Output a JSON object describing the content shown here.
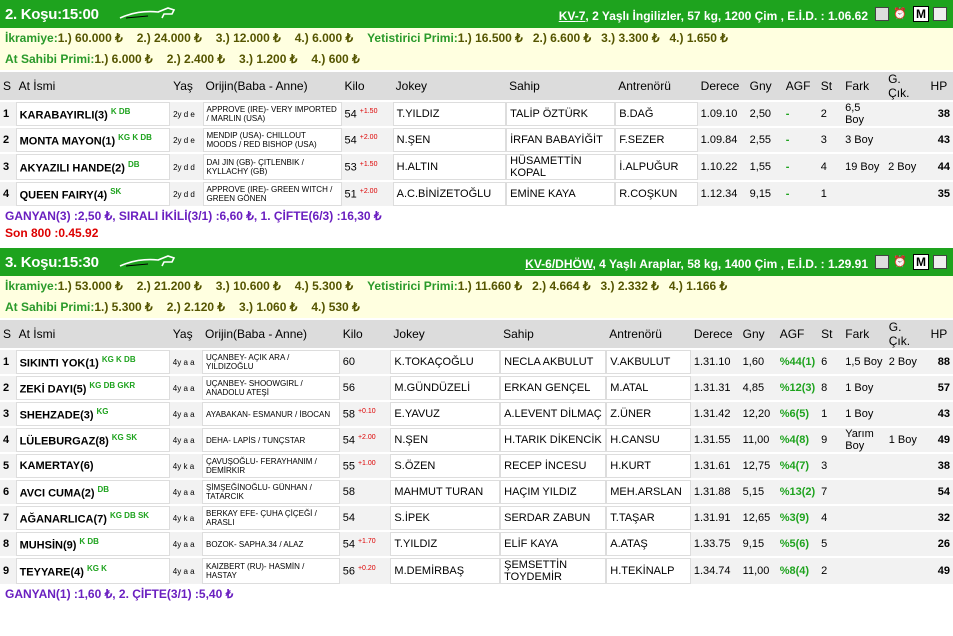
{
  "races": [
    {
      "title": "2. Koşu:15:00",
      "kv": "KV-7",
      "info": ", 2 Yaşlı İngilizler, 57 kg, 1200 Çim , E.İ.D. : 1.06.62",
      "ikramiye_label": "İkramiye:",
      "ikramiye": [
        "1.) 60.000 ₺",
        "2.) 24.000 ₺",
        "3.) 12.000 ₺",
        "4.) 6.000 ₺"
      ],
      "yet_label": "Yetistirici Primi:",
      "yet": [
        "1.) 16.500 ₺",
        "2.) 6.600 ₺",
        "3.) 3.300 ₺",
        "4.) 1.650 ₺"
      ],
      "sahip_label": "At Sahibi Primi:",
      "sahip": [
        "1.) 6.000 ₺",
        "2.) 2.400 ₺",
        "3.) 1.200 ₺",
        "4.) 600 ₺"
      ],
      "headers": [
        "S",
        "At İsmi",
        "Yaş",
        "Orijin(Baba - Anne)",
        "Kilo",
        "Jokey",
        "Sahip",
        "Antrenörü",
        "Derece",
        "Gny",
        "AGF",
        "St",
        "Fark",
        "G. Çık.",
        "HP"
      ],
      "rows": [
        {
          "s": "1",
          "name": "KARABAYIRLI(3)",
          "eq": "K DB",
          "yas": "2y d e",
          "orig": "APPROVE (IRE)- VERY IMPORTED / MARLIN (USA)",
          "kilo": "54",
          "kx": "+1.50",
          "jokey": "T.YILDIZ",
          "sahip": "TALİP ÖZTÜRK",
          "antr": "B.DAĞ",
          "derece": "1.09.10",
          "gny": "2,50",
          "agf": "-",
          "st": "2",
          "fark": "6,5 Boy",
          "gcik": "",
          "hp": "38"
        },
        {
          "s": "2",
          "name": "MONTA MAYON(1)",
          "eq": "KG K DB",
          "yas": "2y d e",
          "orig": "MENDIP (USA)- CHILLOUT MOODS / RED BISHOP (USA)",
          "kilo": "54",
          "kx": "+2.00",
          "jokey": "N.ŞEN",
          "sahip": "İRFAN BABAYİĞİT",
          "antr": "F.SEZER",
          "derece": "1.09.84",
          "gny": "2,55",
          "agf": "-",
          "st": "3",
          "fark": "3 Boy",
          "gcik": "",
          "hp": "43"
        },
        {
          "s": "3",
          "name": "AKYAZILI HANDE(2)",
          "eq": "DB",
          "yas": "2y d d",
          "orig": "DAI JIN (GB)- ÇITLENBIK / KYLLACHY (GB)",
          "kilo": "53",
          "kx": "+1.50",
          "jokey": "H.ALTIN",
          "sahip": "HÜSAMETTİN KOPAL",
          "antr": "İ.ALPUĞUR",
          "derece": "1.10.22",
          "gny": "1,55",
          "agf": "-",
          "st": "4",
          "fark": "19 Boy",
          "gcik": "2 Boy",
          "hp": "44"
        },
        {
          "s": "4",
          "name": "QUEEN FAIRY(4)",
          "eq": "SK",
          "yas": "2y d d",
          "orig": "APPROVE (IRE)- GREEN WITCH / GREEN GÖNEN",
          "kilo": "51",
          "kx": "+2.00",
          "jokey": "A.C.BİNİZETOĞLU",
          "sahip": "EMİNE KAYA",
          "antr": "R.COŞKUN",
          "derece": "1.12.34",
          "gny": "9,15",
          "agf": "-",
          "st": "1",
          "fark": "",
          "gcik": "",
          "hp": "35"
        }
      ],
      "result": "GANYAN(3) :2,50 ₺, SIRALI İKİLİ(3/1) :6,60 ₺, 1. ÇİFTE(6/3) :16,30 ₺",
      "son": "Son 800 :0.45.92"
    },
    {
      "title": "3. Koşu:15:30",
      "kv": "KV-6/DHÖW",
      "info": ", 4 Yaşlı Araplar, 58 kg, 1400 Çim , E.İ.D. : 1.29.91",
      "ikramiye_label": "İkramiye:",
      "ikramiye": [
        "1.) 53.000 ₺",
        "2.) 21.200 ₺",
        "3.) 10.600 ₺",
        "4.) 5.300 ₺"
      ],
      "yet_label": "Yetistirici Primi:",
      "yet": [
        "1.) 11.660 ₺",
        "2.) 4.664 ₺",
        "3.) 2.332 ₺",
        "4.) 1.166 ₺"
      ],
      "sahip_label": "At Sahibi Primi:",
      "sahip": [
        "1.) 5.300 ₺",
        "2.) 2.120 ₺",
        "3.) 1.060 ₺",
        "4.) 530 ₺"
      ],
      "headers": [
        "S",
        "At İsmi",
        "Yaş",
        "Orijin(Baba - Anne)",
        "Kilo",
        "Jokey",
        "Sahip",
        "Antrenörü",
        "Derece",
        "Gny",
        "AGF",
        "St",
        "Fark",
        "G. Çık.",
        "HP"
      ],
      "rows": [
        {
          "s": "1",
          "name": "SIKINTI YOK(1)",
          "eq": "KG K DB",
          "yas": "4y a a",
          "orig": "UÇANBEY- AÇIK ARA / YILDIZOĞLU",
          "kilo": "60",
          "kx": "",
          "jokey": "K.TOKAÇOĞLU",
          "sahip": "NECLA AKBULUT",
          "antr": "V.AKBULUT",
          "derece": "1.31.10",
          "gny": "1,60",
          "agf": "%44(1)",
          "st": "6",
          "fark": "1,5 Boy",
          "gcik": "2 Boy",
          "hp": "88"
        },
        {
          "s": "2",
          "name": "ZEKİ DAYI(5)",
          "eq": "KG DB GKR",
          "yas": "4y a a",
          "orig": "UÇANBEY- SHOOWGIRL / ANADOLU ATEŞİ",
          "kilo": "56",
          "kx": "",
          "jokey": "M.GÜNDÜZELİ",
          "sahip": "ERKAN GENÇEL",
          "antr": "M.ATAL",
          "derece": "1.31.31",
          "gny": "4,85",
          "agf": "%12(3)",
          "st": "8",
          "fark": "1 Boy",
          "gcik": "",
          "hp": "57"
        },
        {
          "s": "3",
          "name": "SHEHZADE(3)",
          "eq": "KG",
          "yas": "4y a a",
          "orig": "AYABAKAN- ESMANUR / İBOCAN",
          "kilo": "58",
          "kx": "+0.10",
          "jokey": "E.YAVUZ",
          "sahip": "A.LEVENT DİLMAÇ",
          "antr": "Z.ÜNER",
          "derece": "1.31.42",
          "gny": "12,20",
          "agf": "%6(5)",
          "st": "1",
          "fark": "1 Boy",
          "gcik": "",
          "hp": "43"
        },
        {
          "s": "4",
          "name": "LÜLEBURGAZ(8)",
          "eq": "KG SK",
          "yas": "4y a a",
          "orig": "DEHA- LAPİS / TUNÇSTAR",
          "kilo": "54",
          "kx": "+2.00",
          "jokey": "N.ŞEN",
          "sahip": "H.TARIK DİKENCİK",
          "antr": "H.CANSU",
          "derece": "1.31.55",
          "gny": "11,00",
          "agf": "%4(8)",
          "st": "9",
          "fark": "Yarım Boy",
          "gcik": "1 Boy",
          "hp": "49"
        },
        {
          "s": "5",
          "name": "KAMERTAY(6)",
          "eq": "",
          "yas": "4y k a",
          "orig": "ÇAVUŞOĞLU- FERAYHANIM / DEMİRKIR",
          "kilo": "55",
          "kx": "+1.00",
          "jokey": "S.ÖZEN",
          "sahip": "RECEP İNCESU",
          "antr": "H.KURT",
          "derece": "1.31.61",
          "gny": "12,75",
          "agf": "%4(7)",
          "st": "3",
          "fark": "",
          "gcik": "",
          "hp": "38"
        },
        {
          "s": "6",
          "name": "AVCI CUMA(2)",
          "eq": "DB",
          "yas": "4y a a",
          "orig": "ŞİMŞEĞİNOĞLU- GÜNHAN / TATARCIK",
          "kilo": "58",
          "kx": "",
          "jokey": "MAHMUT TURAN",
          "sahip": "HAÇIM YILDIZ",
          "antr": "MEH.ARSLAN",
          "derece": "1.31.88",
          "gny": "5,15",
          "agf": "%13(2)",
          "st": "7",
          "fark": "",
          "gcik": "",
          "hp": "54"
        },
        {
          "s": "7",
          "name": "AĞANARLICA(7)",
          "eq": "KG DB SK",
          "yas": "4y k a",
          "orig": "BERKAY EFE- ÇUHA ÇİÇEĞİ / ARASLI",
          "kilo": "54",
          "kx": "",
          "jokey": "S.İPEK",
          "sahip": "SERDAR ZABUN",
          "antr": "T.TAŞAR",
          "derece": "1.31.91",
          "gny": "12,65",
          "agf": "%3(9)",
          "st": "4",
          "fark": "",
          "gcik": "",
          "hp": "32"
        },
        {
          "s": "8",
          "name": "MUHSİN(9)",
          "eq": "K DB",
          "yas": "4y a a",
          "orig": "BOZOK- SAPHA.34 / ALAZ",
          "kilo": "54",
          "kx": "+1.70",
          "jokey": "T.YILDIZ",
          "sahip": "ELİF KAYA",
          "antr": "A.ATAŞ",
          "derece": "1.33.75",
          "gny": "9,15",
          "agf": "%5(6)",
          "st": "5",
          "fark": "",
          "gcik": "",
          "hp": "26"
        },
        {
          "s": "9",
          "name": "TEYYARE(4)",
          "eq": "KG K",
          "yas": "4y a a",
          "orig": "KAIZBERT (RU)- HASMİN / HASTAY",
          "kilo": "56",
          "kx": "+0.20",
          "jokey": "M.DEMİRBAŞ",
          "sahip": "ŞEMSETTİN TOYDEMİR",
          "antr": "H.TEKİNALP",
          "derece": "1.34.74",
          "gny": "11,00",
          "agf": "%8(4)",
          "st": "2",
          "fark": "",
          "gcik": "",
          "hp": "49"
        }
      ],
      "result": "GANYAN(1) :1,60 ₺, 2. ÇİFTE(3/1) :5,40 ₺",
      "son": ""
    }
  ],
  "icons": {
    "m_label": "M",
    "alarm_label": "⏰"
  }
}
